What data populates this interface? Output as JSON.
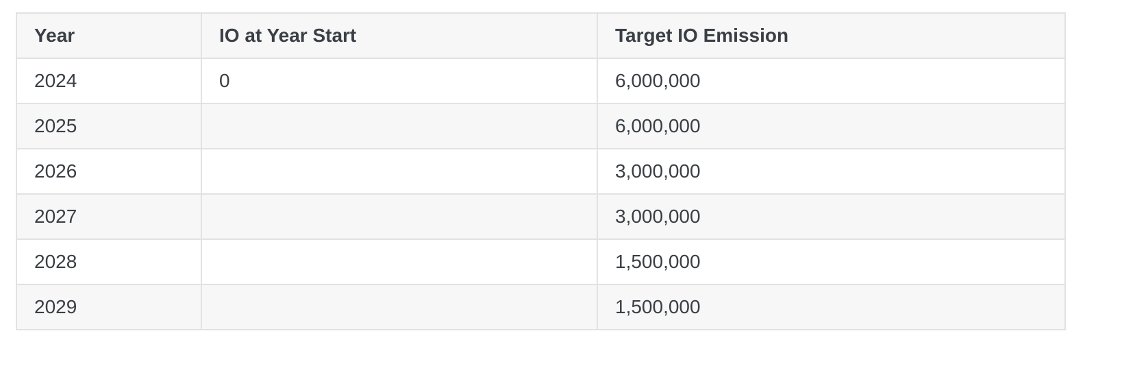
{
  "table": {
    "headers": [
      "Year",
      "IO at Year Start",
      "Target IO Emission"
    ],
    "rows": [
      [
        "2024",
        "0",
        "6,000,000"
      ],
      [
        "2025",
        "",
        "6,000,000"
      ],
      [
        "2026",
        "",
        "3,000,000"
      ],
      [
        "2027",
        "",
        "3,000,000"
      ],
      [
        "2028",
        "",
        "1,500,000"
      ],
      [
        "2029",
        "",
        "1,500,000"
      ]
    ]
  }
}
